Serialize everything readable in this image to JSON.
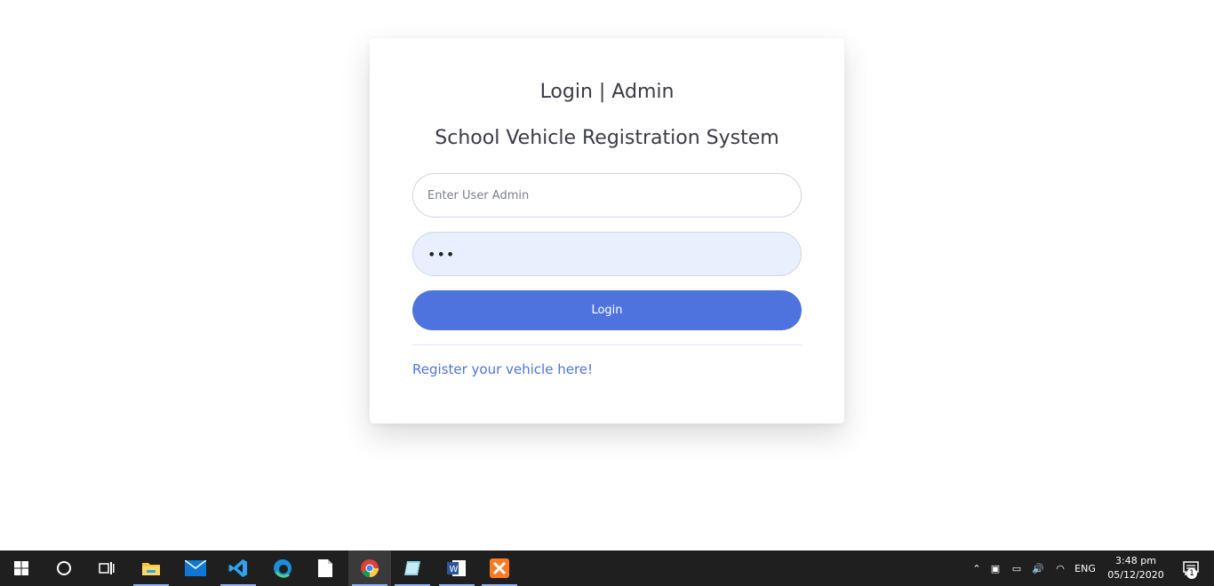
{
  "login": {
    "title": "Login | Admin",
    "subtitle": "School Vehicle Registration System",
    "username_placeholder": "Enter User Admin",
    "password_value": "•••",
    "login_button": "Login",
    "register_link": "Register your vehicle here!"
  },
  "colors": {
    "accent": "#4e73df",
    "password_autofill_bg": "#e8f0fe",
    "taskbar": "#1f1f1f"
  },
  "taskbar": {
    "apps": [
      "start-icon",
      "cortana-icon",
      "task-view-icon",
      "file-explorer-icon",
      "mail-icon",
      "vscode-icon",
      "edge-icon",
      "notepad-icon",
      "chrome-icon",
      "notebook-icon",
      "word-icon",
      "xampp-icon"
    ],
    "language": "ENG",
    "time": "3:48 pm",
    "date": "05/12/2020",
    "notification_count": "1"
  }
}
